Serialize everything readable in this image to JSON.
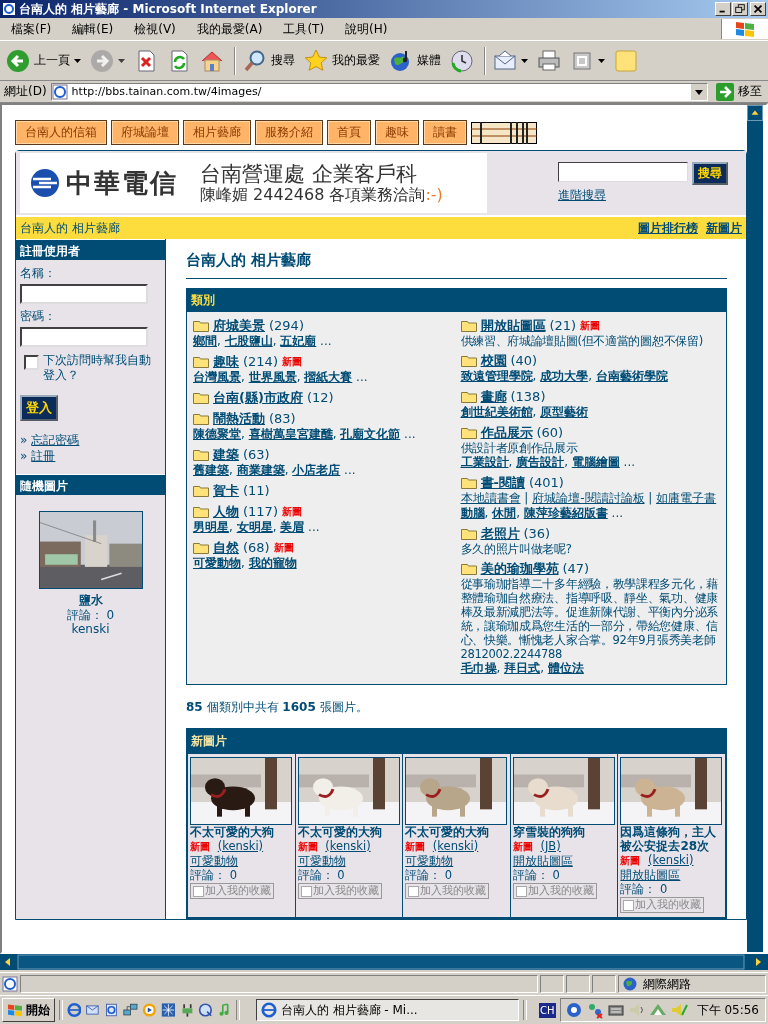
{
  "window": {
    "title": "台南人的 相片藝廊 - Microsoft Internet Explorer"
  },
  "menu": [
    "檔案(F)",
    "編輯(E)",
    "檢視(V)",
    "我的最愛(A)",
    "工具(T)",
    "說明(H)"
  ],
  "toolbar": [
    {
      "kind": "back",
      "label": "上一頁",
      "dropdown": true,
      "separator_before": false,
      "disabled": false
    },
    {
      "kind": "forward",
      "dropdown": true,
      "separator_before": false,
      "disabled": true
    },
    {
      "kind": "stop",
      "dropdown": false,
      "separator_before": false,
      "disabled": false
    },
    {
      "kind": "refresh",
      "dropdown": false,
      "separator_before": false,
      "disabled": false
    },
    {
      "kind": "home",
      "dropdown": false,
      "separator_before": false,
      "disabled": false
    },
    {
      "kind": "search",
      "label": "搜尋",
      "dropdown": false,
      "separator_before": true,
      "disabled": false
    },
    {
      "kind": "favorites",
      "label": "我的最愛",
      "dropdown": false,
      "separator_before": false,
      "disabled": false
    },
    {
      "kind": "media",
      "label": "媒體",
      "dropdown": false,
      "separator_before": false,
      "disabled": false
    },
    {
      "kind": "history",
      "dropdown": false,
      "separator_before": false,
      "disabled": false
    },
    {
      "kind": "mail",
      "dropdown": true,
      "separator_before": true,
      "disabled": false
    },
    {
      "kind": "print",
      "dropdown": false,
      "separator_before": false,
      "disabled": false
    },
    {
      "kind": "edit",
      "dropdown": true,
      "separator_before": false,
      "disabled": false
    },
    {
      "kind": "discuss",
      "dropdown": false,
      "separator_before": false,
      "disabled": false
    }
  ],
  "address": {
    "label": "網址(D)",
    "url": "http://bbs.tainan.com.tw/4images/",
    "go": "移至"
  },
  "nav_tabs": [
    "台南人的信箱",
    "府城論壇",
    "相片藝廊",
    "服務介紹",
    "首頁",
    "趣味",
    "讀書"
  ],
  "banner": {
    "logo_text": "中華電信",
    "line_1": "台南營運處  企業客戶科",
    "line_2": "陳峰媚  2442468  各項業務洽詢",
    "smiley": ":-)"
  },
  "search": {
    "button": "搜尋",
    "advanced": "進階搜尋"
  },
  "breadcrumb": "台南人的 相片藝廊",
  "top_links": [
    "圖片排行榜",
    "新圖片"
  ],
  "login": {
    "title": "註冊使用者",
    "name_label": "名稱：",
    "password_label": "密碼：",
    "remember": {
      "label": "下次訪問時幫我自動登入？",
      "checked": false
    },
    "submit": "登入",
    "links": [
      {
        "marker": "»",
        "label": "忘記密碼"
      },
      {
        "marker": "»",
        "label": "註冊"
      }
    ]
  },
  "random_image": {
    "title": "隨機圖片",
    "kind": "picture",
    "caption": "鹽水",
    "comments": "評論： 0",
    "user": "kenski"
  },
  "heading": "台南人的 相片藝廊",
  "categories": {
    "title": "類別",
    "columns": [
      [
        {
          "name": "府城美景",
          "count": "(294)",
          "new": false,
          "lines": [
            {
              "kind": "subcategories",
              "links": [
                "鄉間",
                "七股鹽山",
                "五妃廟"
              ],
              "separator": ", ",
              "more": "..."
            }
          ]
        },
        {
          "name": "趣味",
          "count": "(214)",
          "new": true,
          "badge": "新圖",
          "lines": [
            {
              "kind": "subcategories",
              "links": [
                "台灣風景",
                "世界風景",
                "摺紙大賽"
              ],
              "separator": ", ",
              "more": "..."
            }
          ]
        },
        {
          "name": "台南(縣)市政府",
          "count": "(12)",
          "new": false
        },
        {
          "name": "鬧熱活動",
          "count": "(83)",
          "new": false,
          "lines": [
            {
              "kind": "subcategories",
              "links": [
                "陳德聚堂",
                "喜樹萬皇宮建醮",
                "孔廟文化節"
              ],
              "separator": ", ",
              "more": "..."
            }
          ]
        },
        {
          "name": "建築",
          "count": "(63)",
          "new": false,
          "lines": [
            {
              "kind": "subcategories",
              "links": [
                "舊建築",
                "商業建築",
                "小店老店"
              ],
              "separator": ", ",
              "more": "..."
            }
          ]
        },
        {
          "name": "賀卡",
          "count": "(11)",
          "new": false
        },
        {
          "name": "人物",
          "count": "(117)",
          "new": true,
          "badge": "新圖",
          "lines": [
            {
              "kind": "subcategories",
              "links": [
                "男明星",
                "女明星",
                "美眉"
              ],
              "separator": ", ",
              "more": "..."
            }
          ]
        },
        {
          "name": "自然",
          "count": "(68)",
          "new": true,
          "badge": "新圖",
          "lines": [
            {
              "kind": "subcategories",
              "links": [
                "可愛動物",
                "我的寵物"
              ],
              "separator": ", "
            }
          ]
        }
      ],
      [
        {
          "name": "開放貼圖區",
          "count": "(21)",
          "new": true,
          "badge": "新圖",
          "description": "供練習、府城論壇貼圖(但不適當的圖恕不保留)"
        },
        {
          "name": "校園",
          "count": "(40)",
          "new": false,
          "lines": [
            {
              "kind": "subcategories",
              "links": [
                "致遠管理學院",
                "成功大學",
                "台南藝術學院"
              ],
              "separator": ", "
            }
          ]
        },
        {
          "name": "畫廊",
          "count": "(138)",
          "new": false,
          "lines": [
            {
              "kind": "subcategories",
              "links": [
                "創世紀美術館",
                "原型藝術"
              ],
              "separator": ", "
            }
          ]
        },
        {
          "name": "作品展示",
          "count": "(60)",
          "new": false,
          "description": "供設計者原創作品展示",
          "lines": [
            {
              "kind": "subcategories",
              "links": [
                "工業設計",
                "廣告設計",
                "電腦繪圖"
              ],
              "separator": ", ",
              "more": "..."
            }
          ]
        },
        {
          "name": "書-閱讀",
          "count": "(401)",
          "new": false,
          "lines": [
            {
              "kind": "links",
              "links": [
                "本地讀書會",
                "府城論壇-閱讀討論板",
                "如庸電子書"
              ],
              "separator": " | "
            },
            {
              "kind": "subcategories",
              "links": [
                "動腦",
                "休閒",
                "陳萍珍藝紹版書"
              ],
              "separator": ", ",
              "more": "..."
            }
          ]
        },
        {
          "name": "老照片",
          "count": "(36)",
          "new": false,
          "description": "多久的照片叫做老呢?"
        },
        {
          "name": "美的瑜珈學苑",
          "count": "(47)",
          "new": false,
          "description": "從事瑜珈指導二十多年經驗，教學課程多元化，藉整體瑜珈自然療法、指導呼吸、靜坐、氣功、健康棒及最新減肥法等。促進新陳代謝、平衡內分泌系統，讓瑜珈成爲您生活的一部分，帶給您健康、信心、快樂。慚愧老人家合掌。92年9月張秀美老師 2812002.2244788",
          "lines": [
            {
              "kind": "subcategories",
              "links": [
                "毛巾操",
                "拜日式",
                "體位法"
              ],
              "separator": ", "
            }
          ]
        }
      ]
    ]
  },
  "stats": "**85** 個類別中共有 **1605** 張圖片。",
  "new_images": {
    "title": "新圖片",
    "items": [
      {
        "kind": "picture",
        "title": "不太可愛的大狗",
        "new": true,
        "badge": "新圖",
        "user": "(kenski)",
        "category": "可愛動物",
        "comments": "評論： 0",
        "favorite": {
          "label": "加入我的收藏",
          "checked": false
        }
      },
      {
        "kind": "picture",
        "title": "不太可愛的大狗",
        "new": true,
        "badge": "新圖",
        "user": "(kenski)",
        "category": "可愛動物",
        "comments": "評論： 0",
        "favorite": {
          "label": "加入我的收藏",
          "checked": false
        }
      },
      {
        "kind": "picture",
        "title": "不太可愛的大狗",
        "new": true,
        "badge": "新圖",
        "user": "(kenski)",
        "category": "可愛動物",
        "comments": "評論： 0",
        "favorite": {
          "label": "加入我的收藏",
          "checked": false
        }
      },
      {
        "kind": "picture",
        "title": "穿雪裝的狗狗",
        "new": true,
        "badge": "新圖",
        "user": "(JB)",
        "category": "開放貼圖區",
        "comments": "評論： 0",
        "favorite": {
          "label": "加入我的收藏",
          "checked": false
        }
      },
      {
        "kind": "picture",
        "title": "因爲這條狗，主人被公安捉去28次",
        "new": true,
        "badge": "新圖",
        "user": "(kenski)",
        "category": "開放貼圖區",
        "comments": "評論： 0",
        "favorite": {
          "label": "加入我的收藏",
          "checked": false
        }
      }
    ]
  },
  "status_bar": {
    "zone": "網際網路"
  },
  "taskbar": {
    "start": "開始",
    "window": "台南人的 相片藝廊 - Mi...",
    "language": "CH",
    "clock": "下午 05:56"
  }
}
